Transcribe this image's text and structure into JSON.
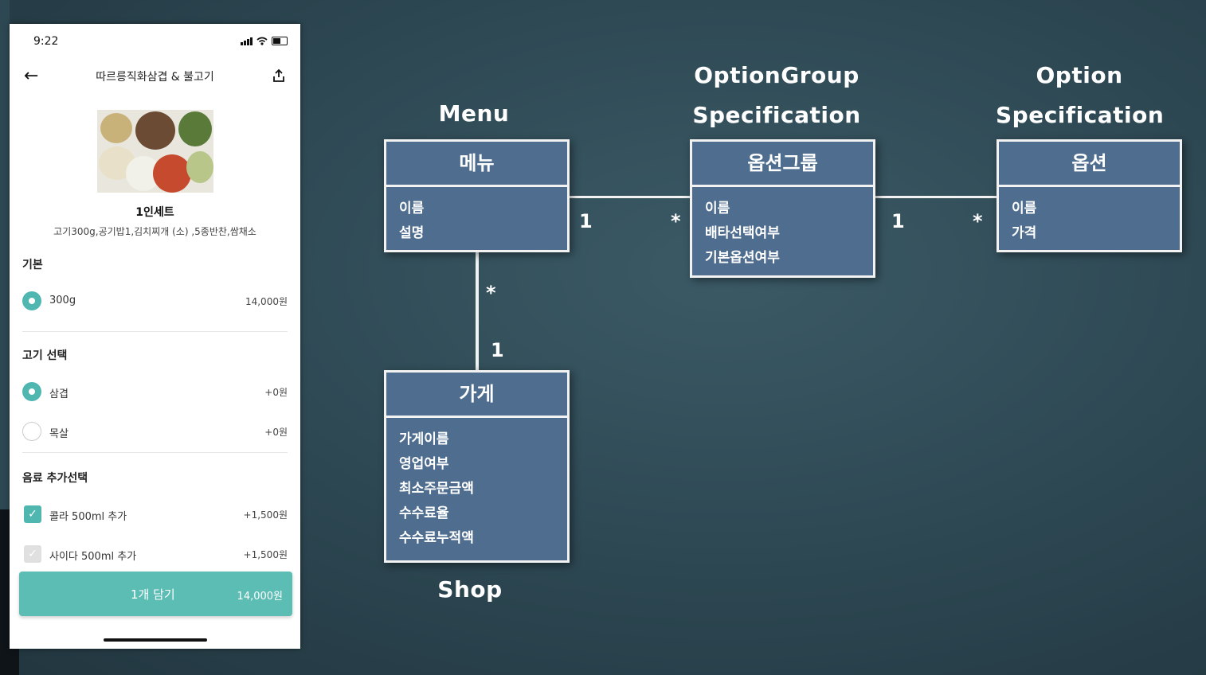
{
  "phone": {
    "status": {
      "time": "9:22"
    },
    "header": {
      "title": "따르릉직화삼겹 & 불고기",
      "back_icon": "arrow-left-icon",
      "share_icon": "share-icon"
    },
    "product": {
      "name": "1인세트",
      "description": "고기300g,공기밥1,김치찌개 (소) ,5종반찬,쌈채소"
    },
    "sections": [
      {
        "title": "기본",
        "options": [
          {
            "label": "300g",
            "price": "14,000원",
            "selected": true,
            "kind": "radio"
          }
        ]
      },
      {
        "title": "고기 선택",
        "options": [
          {
            "label": "삼겹",
            "price": "+0원",
            "selected": true,
            "kind": "radio"
          },
          {
            "label": "목살",
            "price": "+0원",
            "selected": false,
            "kind": "radio"
          }
        ]
      },
      {
        "title": "음료 추가선택",
        "options": [
          {
            "label": "콜라 500ml 추가",
            "price": "+1,500원",
            "selected": true,
            "kind": "checkbox"
          },
          {
            "label": "사이다 500ml 추가",
            "price": "+1,500원",
            "selected": false,
            "kind": "checkbox"
          }
        ]
      }
    ],
    "cart_button": {
      "label": "1개 담기",
      "price": "14,000원"
    },
    "accent_color": "#4fb7b0"
  },
  "diagram": {
    "headings": {
      "menu": "Menu",
      "option_group_1": "OptionGroup",
      "option_group_2": "Specification",
      "option_1": "Option",
      "option_2": "Specification",
      "shop": "Shop"
    },
    "classes": {
      "menu": {
        "title": "메뉴",
        "attributes": [
          "이름",
          "설명"
        ]
      },
      "option_group": {
        "title": "옵션그룹",
        "attributes": [
          "이름",
          "배타선택여부",
          "기본옵션여부"
        ]
      },
      "option": {
        "title": "옵션",
        "attributes": [
          "이름",
          "가격"
        ]
      },
      "shop": {
        "title": "가게",
        "attributes": [
          "가게이름",
          "영업여부",
          "최소주문금액",
          "수수료율",
          "수수료누적액"
        ]
      }
    },
    "multiplicities": {
      "menu_to_group_menu_end": "1",
      "menu_to_group_group_end": "*",
      "group_to_option_group_end": "1",
      "group_to_option_option_end": "*",
      "menu_to_shop_menu_end": "*",
      "menu_to_shop_shop_end": "1"
    },
    "box_color": "#4f6d8f"
  }
}
